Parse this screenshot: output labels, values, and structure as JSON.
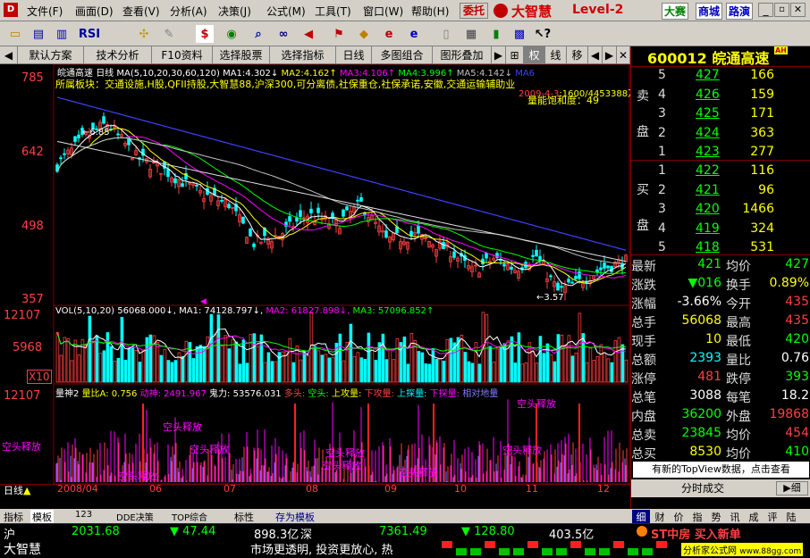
{
  "menu": {
    "items": [
      "文件(F)",
      "画面(D)",
      "查看(V)",
      "分析(A)",
      "决策(J)",
      "公式(M)",
      "工具(T)",
      "窗口(W)",
      "帮助(H)"
    ],
    "entrust": "委托",
    "brand": "大智慧",
    "level": "Level-2",
    "links": [
      "大赛",
      "商城",
      "路演"
    ]
  },
  "toolbar": {
    "icons": [
      "open-icon",
      "chart-icon",
      "kline-icon",
      "rsi-label",
      "ruler-icon",
      "pencil-icon",
      "s-icon",
      "eye-icon",
      "search-icon",
      "binocular-icon",
      "megaphone-icon",
      "flag-icon",
      "warning-icon",
      "ie-icon",
      "ie2-icon",
      "notepad-icon",
      "calc-icon",
      "chart2-icon",
      "quote-icon",
      "arrow-icon",
      "help-icon"
    ],
    "rsi": "RSI",
    "dollar": "$"
  },
  "tabs": [
    "默认方案",
    "技术分析",
    "F10资料",
    "选择股票",
    "选择指标",
    "日线",
    "多图组合",
    "图形叠加",
    "权",
    "线",
    "移"
  ],
  "chart": {
    "title": "皖通高速",
    "period": "日线",
    "ma_label": "MA(5,10,20,30,60,120)",
    "ma_values": [
      {
        "name": "MA1:",
        "value": "4.302",
        "color": "#ffffff"
      },
      {
        "name": "MA2:",
        "value": "4.162",
        "color": "#ffff00"
      },
      {
        "name": "MA3:",
        "value": "4.106",
        "color": "#ff00ff"
      },
      {
        "name": "MA4:",
        "value": "3.996",
        "color": "#00ff00"
      },
      {
        "name": "MA5:",
        "value": "4.142",
        "color": "#c0c0c0"
      },
      {
        "name": "MA6",
        "value": "",
        "color": "#4040ff"
      }
    ],
    "sector": "所属板块：交通设施,H股,QFII持股,大智慧88,沪深300,可分离债,社保重仓,社保承诺,安徽,交通运输辅助业",
    "date_label": "2009-4-3",
    "capacity": "量能饱和度：49",
    "volume_note": "2009-4-3",
    "amount": "1600/4453388万",
    "price_ticks": [
      "785",
      "642",
      "498",
      "357"
    ],
    "high_label": "6.85",
    "low_label": "3.57",
    "vol_label": "VOL(5,10,20)",
    "vol_value": "56068.000",
    "vol_ma1": "MA1: 74128.797",
    "vol_ma2": "MA2: 61827.898",
    "vol_ma3": "MA3: 57096.852",
    "vol_ticks": [
      "12107",
      "5968",
      "X10"
    ],
    "ind_label": "量神2",
    "ind_items": [
      {
        "t": "量比A: 0.756",
        "c": "#ffff00"
      },
      {
        "t": "动神: 2491.967",
        "c": "#ff00ff"
      },
      {
        "t": "鬼力: 53576.031",
        "c": "#ffffff"
      },
      {
        "t": "多头: ",
        "c": "#ff4040"
      },
      {
        "t": "空头: ",
        "c": "#00ff00"
      },
      {
        "t": "上攻量: ",
        "c": "#ffff00"
      },
      {
        "t": "下攻量: ",
        "c": "#ff4040"
      },
      {
        "t": "上探量: ",
        "c": "#00ffff"
      },
      {
        "t": "下探量: ",
        "c": "#ff00ff"
      },
      {
        "t": "相对地量",
        "c": "#8080ff"
      }
    ],
    "ind_ticks": [
      "12107"
    ],
    "release_labels": [
      "空头释放",
      "空头释放",
      "空头释放",
      "空头释放",
      "空头释放",
      "空头释放",
      "空头释放",
      "空头释放",
      "空头释放"
    ],
    "date_axis": {
      "lead": "日线",
      "months": [
        "2008/04",
        "06",
        "07",
        "08",
        "09",
        "10",
        "11",
        "12"
      ]
    }
  },
  "quote": {
    "code": "600012",
    "name": "皖通高速",
    "badge": "AH",
    "ask_label": [
      "卖",
      "盘"
    ],
    "bid_label": [
      "买",
      "盘"
    ],
    "asks": [
      {
        "n": "5",
        "p": "427",
        "v": "166"
      },
      {
        "n": "4",
        "p": "426",
        "v": "159"
      },
      {
        "n": "3",
        "p": "425",
        "v": "171"
      },
      {
        "n": "2",
        "p": "424",
        "v": "363"
      },
      {
        "n": "1",
        "p": "423",
        "v": "277"
      }
    ],
    "bids": [
      {
        "n": "1",
        "p": "422",
        "v": "116"
      },
      {
        "n": "2",
        "p": "421",
        "v": "96"
      },
      {
        "n": "3",
        "p": "420",
        "v": "1466"
      },
      {
        "n": "4",
        "p": "419",
        "v": "324"
      },
      {
        "n": "5",
        "p": "418",
        "v": "531"
      }
    ],
    "stats": [
      {
        "l1": "最新",
        "v1": "421",
        "c1": "#00ff00",
        "l2": "均价",
        "v2": "427",
        "c2": "#00ff00"
      },
      {
        "l1": "涨跌",
        "v1": "▼016",
        "c1": "#00ff00",
        "l2": "换手",
        "v2": "0.89%",
        "c2": "#ffff00"
      },
      {
        "l1": "涨幅",
        "v1": "-3.66%",
        "c1": "#ffffff",
        "l2": "今开",
        "v2": "435",
        "c2": "#ff4040"
      },
      {
        "l1": "总手",
        "v1": "56068",
        "c1": "#ffff00",
        "l2": "最高",
        "v2": "435",
        "c2": "#ff4040"
      },
      {
        "l1": "现手",
        "v1": "10",
        "c1": "#ffff00",
        "l2": "最低",
        "v2": "420",
        "c2": "#00ff00"
      },
      {
        "l1": "总额",
        "v1": "2393",
        "c1": "#00ffff",
        "l2": "量比",
        "v2": "0.76",
        "c2": "#ffffff"
      },
      {
        "l1": "涨停",
        "v1": "481",
        "c1": "#ff4040",
        "l2": "跌停",
        "v2": "393",
        "c2": "#00ff00"
      },
      {
        "l1": "总笔",
        "v1": "3088",
        "c1": "#ffffff",
        "l2": "每笔",
        "v2": "18.2",
        "c2": "#ffffff"
      },
      {
        "l1": "内盘",
        "v1": "36200",
        "c1": "#00ff00",
        "l2": "外盘",
        "v2": "19868",
        "c2": "#ff4040"
      },
      {
        "l1": "总卖",
        "v1": "23845",
        "c1": "#00ff00",
        "l2": "均价",
        "v2": "454",
        "c2": "#ff4040"
      },
      {
        "l1": "总买",
        "v1": "8530",
        "c1": "#ffff00",
        "l2": "均价",
        "v2": "410",
        "c2": "#00ff00"
      }
    ],
    "topview": "有新的TopView数据，点击查看",
    "fenshi": "分时成交",
    "detail": "细",
    "tabs": [
      "细",
      "财",
      "价",
      "指",
      "势",
      "讯",
      "成",
      "评",
      "陆"
    ]
  },
  "bottom_tabs": [
    "指标",
    "模板",
    "123",
    "DDE决策",
    "TOP综合",
    "标性",
    "存为模板"
  ],
  "ticker": {
    "sh": "沪",
    "sh_index": "2031.68",
    "sh_change": "▼ 47.44",
    "sh_amount": "898.3亿",
    "sz": "深",
    "sz_index": "7361.49",
    "sz_change": "▼ 128.80",
    "sz_amount": "403.5亿",
    "news": "ST中房 买入新单"
  },
  "status": {
    "brand": "大智慧",
    "slogan": "市场更透明, 投资更放心, 热",
    "site": "分析家公式网",
    "url": "www.88gg.com"
  }
}
